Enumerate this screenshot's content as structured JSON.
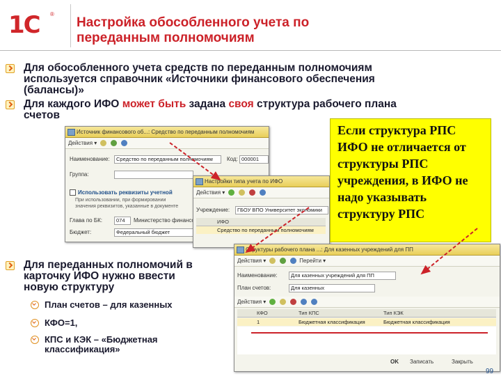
{
  "header": {
    "logo_text": "1С",
    "logo_mark": "®",
    "title_line1": "Настройка обособленного учета по",
    "title_line2": "переданным полномочиям"
  },
  "bullets": {
    "b1_line1": "Для обособленного учета средств по переданным полномочиям",
    "b1_line2": "используется справочник «Источники финансового обеспечения",
    "b1_line3": "(балансы)»",
    "b2_p1": "Для каждого ИФО ",
    "b2_p2": "может быть",
    "b2_p3": " задана ",
    "b2_p4": "своя",
    "b2_p5": " структура рабочего плана",
    "b2_line2": "счетов",
    "b3_line1": "Для переданных полномочий в",
    "b3_line2": "карточку ИФО нужно ввести",
    "b3_line3": "новую структуру",
    "sub1": "План счетов – для казенных",
    "sub2": "КФО=1,",
    "sub3_line1": "КПС и КЭК – «Бюджетная",
    "sub3_line2": "классификация»"
  },
  "note": {
    "line1": "Если структура РПС",
    "line2": "ИФО не отличается от",
    "line3": "структуры РПС",
    "line4": "учреждения, в ИФО не",
    "line5": "надо указывать",
    "line6": "структуру РПС"
  },
  "win1": {
    "title": "Источник финансового об...: Средство по переданным полномочиям",
    "toolbar_actions": "Действия ▾",
    "name_label": "Наименование:",
    "name_value": "Средство по переданным полномочиям",
    "code_label": "Код:",
    "code_value": "000001",
    "group_label": "Группа:",
    "use_req_label": "Использовать реквизиты учетной",
    "desc_line1": "При использовании, при формировании",
    "desc_line2": "значения реквизитов, указанные в документе",
    "glava_label": "Глава по БК:",
    "glava_value": "074",
    "glava_desc": "Министерство финансов...",
    "budget_label": "Бюджет:",
    "budget_value": "Федеральный бюджет"
  },
  "win2": {
    "title": "Настройки типа учета по ИФО",
    "toolbar_actions": "Действия ▾",
    "inst_label": "Учреждение:",
    "inst_value": "ГБОУ ВПО Университет экономики",
    "col_ifo": "ИФО",
    "row_value": "Средство по переданным полномочиям"
  },
  "win3": {
    "title": "Структуры рабочего плана ...: Для казенных учреждений для ПП",
    "toolbar_actions": "Действия ▾",
    "toolbar_goto": "Перейти ▾",
    "name_label": "Наименование:",
    "name_value": "Для казенных учреждений для ПП",
    "plan_label": "План счетов:",
    "plan_value": "Для казенных",
    "col_kfo": "КФО",
    "col_kps": "Тип КПС",
    "col_kek": "Тип КЭК",
    "row_kfo": "1",
    "row_kps": "Бюджетная классификация",
    "row_kek": "Бюджетная классификация",
    "btn_ok": "OK",
    "btn_save": "Записать",
    "btn_close": "Закрыть"
  },
  "slide_number": "99",
  "colors": {
    "title_red": "#cc2229",
    "note_yellow": "#ffff00",
    "arrow_red": "#cc2229"
  }
}
